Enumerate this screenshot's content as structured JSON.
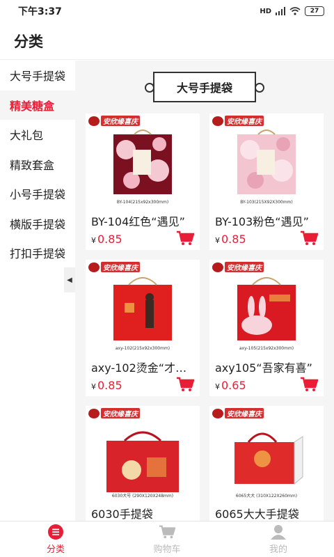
{
  "status_bar": {
    "time": "下午3:37",
    "signal": "HD",
    "battery": "27"
  },
  "header": {
    "title": "分类"
  },
  "sidebar": {
    "items": [
      {
        "label": "大号手提袋",
        "active": false
      },
      {
        "label": "精美糖盒",
        "active": true
      },
      {
        "label": "大礼包",
        "active": false
      },
      {
        "label": "精致套盒",
        "active": false
      },
      {
        "label": "小号手提袋",
        "active": false
      },
      {
        "label": "横版手提袋",
        "active": false
      },
      {
        "label": "打扣手提袋",
        "active": false
      }
    ]
  },
  "section": {
    "title": "大号手提袋"
  },
  "products": [
    {
      "name": "BY-104红色“遇见”",
      "currency": "¥",
      "price": "0.85",
      "spec": "BY-104(215x92x300mm)",
      "color": "#7a1020"
    },
    {
      "name": "BY-103粉色“遇见”",
      "currency": "¥",
      "price": "0.85",
      "spec": "BY-103(215X92X300mm)",
      "color": "#f2b8c6"
    },
    {
      "name": "axy-102烫金“才…",
      "currency": "¥",
      "price": "0.85",
      "spec": "axy-102(215x92x300mm)",
      "color": "#e0201e"
    },
    {
      "name": "axy105“吾家有喜”",
      "currency": "¥",
      "price": "0.65",
      "spec": "axy-105(215x92x300mm)",
      "color": "#d91a22"
    },
    {
      "name": "6030手提袋",
      "currency": "¥",
      "price": "",
      "spec": "6030大号 (290X120X248mm)",
      "color": "#d9232a"
    },
    {
      "name": "6065大大手提袋",
      "currency": "¥",
      "price": "",
      "spec": "6065大大 (310X122X260mm)",
      "color": "#e02b2b"
    }
  ],
  "brand_label": "安欣缘喜庆",
  "tabbar": {
    "items": [
      {
        "label": "分类",
        "icon": "menu-icon",
        "active": true
      },
      {
        "label": "购物车",
        "icon": "cart-icon",
        "active": false
      },
      {
        "label": "我的",
        "icon": "user-icon",
        "active": false
      }
    ]
  },
  "colors": {
    "accent": "#e91e36",
    "sidebar_active_bg": "#f5f5f5",
    "content_bg": "#f5f5f5"
  }
}
